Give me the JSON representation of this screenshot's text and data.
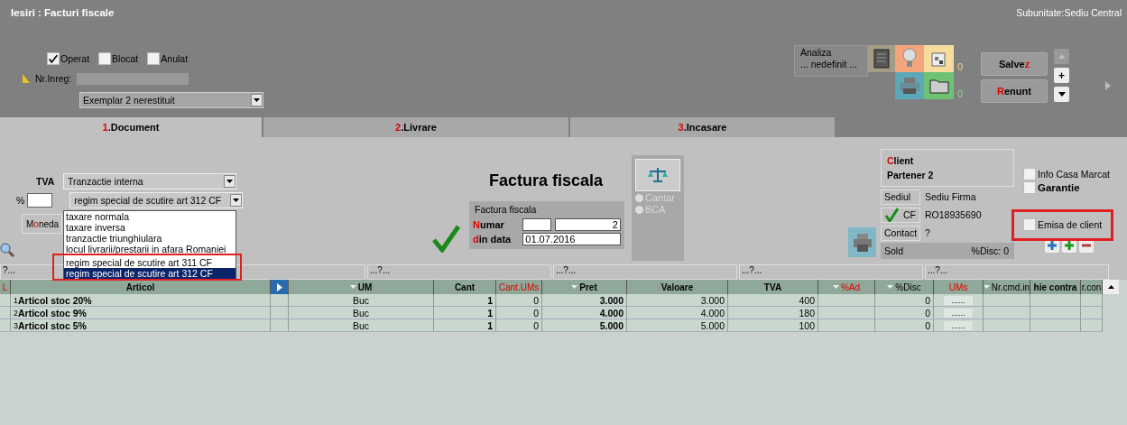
{
  "window": {
    "title": "Iesiri : Facturi fiscale",
    "subunit": "Subunitate:Sediu Central"
  },
  "status_checks": [
    {
      "label": "Operat",
      "checked": true
    },
    {
      "label": "Blocat",
      "checked": false
    },
    {
      "label": "Anulat",
      "checked": false
    }
  ],
  "nr_inreg": {
    "label": "Nr.Inreg:"
  },
  "copy_select": {
    "value": "Exemplar 2 nerestituit"
  },
  "analiza": {
    "label": "Analiza",
    "value": "... nedefinit ..."
  },
  "counters": [
    "0",
    "0"
  ],
  "actions": [
    {
      "pre": "Salve",
      "accent": "z"
    },
    {
      "accent": "R",
      "post": "enunt"
    }
  ],
  "nav_buttons": [
    {
      "kind": "up",
      "disabled": true
    },
    {
      "kind": "plus",
      "label": "+",
      "disabled": false
    },
    {
      "kind": "down",
      "disabled": false
    }
  ],
  "tabs": [
    {
      "accent": "1",
      "post": ".Document",
      "selected": true
    },
    {
      "accent": "2",
      "post": ".Livrare",
      "selected": false
    },
    {
      "accent": "3",
      "post": ".Incasare",
      "selected": false
    }
  ],
  "tva": {
    "label": "TVA",
    "type": "Tranzactie interna",
    "percent_label": "%",
    "regime": "regim special de scutire art 312 CF",
    "currency": {
      "pre": "M",
      "accent": "o",
      "post": "neda"
    },
    "options": [
      {
        "label": "taxare normala",
        "selected": false
      },
      {
        "label": "taxare inversa",
        "selected": false
      },
      {
        "label": "tranzactie triunghiulara",
        "selected": false
      },
      {
        "label": "locul livrarii/prestarii in afara Romaniei",
        "selected": false
      },
      {
        "label": "regim special de scutire art 311 CF",
        "selected": false
      },
      {
        "label": "regim special de scutire art 312 CF",
        "selected": true
      }
    ]
  },
  "document": {
    "title": "Factura fiscala",
    "group": "Factura fiscala",
    "number_label": {
      "accent": "N",
      "post": "umar"
    },
    "number": "2",
    "date_label": {
      "accent": "d",
      "post": "in data"
    },
    "date": "01.07.2016",
    "radios": [
      {
        "label": "Cantar",
        "selected": false,
        "disabled": true
      },
      {
        "label": "BCA",
        "selected": false,
        "disabled": true
      }
    ]
  },
  "client": {
    "label": {
      "accent": "C",
      "post": "lient"
    },
    "name": "Partener 2",
    "seat_label": "Sediul",
    "seat": "Sediu Firma",
    "cf_label": "CF",
    "cf": "RO18935690",
    "contact_label": "Contact",
    "contact": "?",
    "sold_label": "Sold",
    "discount": "%Disc: 0"
  },
  "side_checks": [
    {
      "label": "Info Casa Marcat",
      "checked": false,
      "bold": false
    },
    {
      "label": "Garantie",
      "checked": false,
      "bold": true
    },
    {
      "label": "Emisa de client",
      "checked": false,
      "bold": false
    }
  ],
  "filters": [
    "?...",
    "...?...",
    "...?...",
    "...?...",
    "...?..."
  ],
  "table": {
    "columns": [
      {
        "kind": "text",
        "label": "L",
        "sorted": false,
        "highlighted": true,
        "bold": false
      },
      {
        "kind": "text",
        "label": "Articol",
        "sorted": false,
        "highlighted": false,
        "bold": true
      },
      {
        "kind": "button"
      },
      {
        "kind": "text",
        "label": "UM",
        "sorted": true,
        "highlighted": false,
        "bold": true
      },
      {
        "kind": "text",
        "label": "Cant",
        "sorted": false,
        "highlighted": false,
        "bold": true
      },
      {
        "kind": "text",
        "label": "Cant.UMs",
        "sorted": false,
        "highlighted": true,
        "bold": false
      },
      {
        "kind": "text",
        "label": "Pret",
        "sorted": true,
        "highlighted": false,
        "bold": true
      },
      {
        "kind": "text",
        "label": "Valoare",
        "sorted": false,
        "highlighted": false,
        "bold": true
      },
      {
        "kind": "text",
        "label": "TVA",
        "sorted": false,
        "highlighted": false,
        "bold": true
      },
      {
        "kind": "text",
        "label": "%Ad",
        "sorted": true,
        "highlighted": true,
        "bold": false
      },
      {
        "kind": "text",
        "label": "%Disc",
        "sorted": true,
        "highlighted": false,
        "bold": false
      },
      {
        "kind": "text",
        "label": "UMs",
        "sorted": false,
        "highlighted": true,
        "bold": false
      },
      {
        "kind": "text",
        "label": "Nr.cmd.in",
        "sorted": true,
        "highlighted": false,
        "bold": false
      },
      {
        "kind": "text",
        "label": "hie contra",
        "sorted": false,
        "highlighted": false,
        "bold": true
      },
      {
        "kind": "text",
        "label": "r.con",
        "sorted": false,
        "highlighted": false,
        "bold": false
      }
    ],
    "rows": [
      {
        "number": "1",
        "article": "Articol stoc 20%",
        "um": "Buc",
        "qty": "1",
        "qty_ums": "0",
        "price": "3.000",
        "value": "3.000",
        "vat": "400",
        "discount": "0",
        "ums": "......"
      },
      {
        "number": "2",
        "article": "Articol stoc 9%",
        "um": "Buc",
        "qty": "1",
        "qty_ums": "0",
        "price": "4.000",
        "value": "4.000",
        "vat": "180",
        "discount": "0",
        "ums": "......"
      },
      {
        "number": "3",
        "article": "Articol stoc 5%",
        "um": "Buc",
        "qty": "1",
        "qty_ums": "0",
        "price": "5.000",
        "value": "5.000",
        "vat": "100",
        "discount": "0",
        "ums": "......"
      }
    ]
  }
}
